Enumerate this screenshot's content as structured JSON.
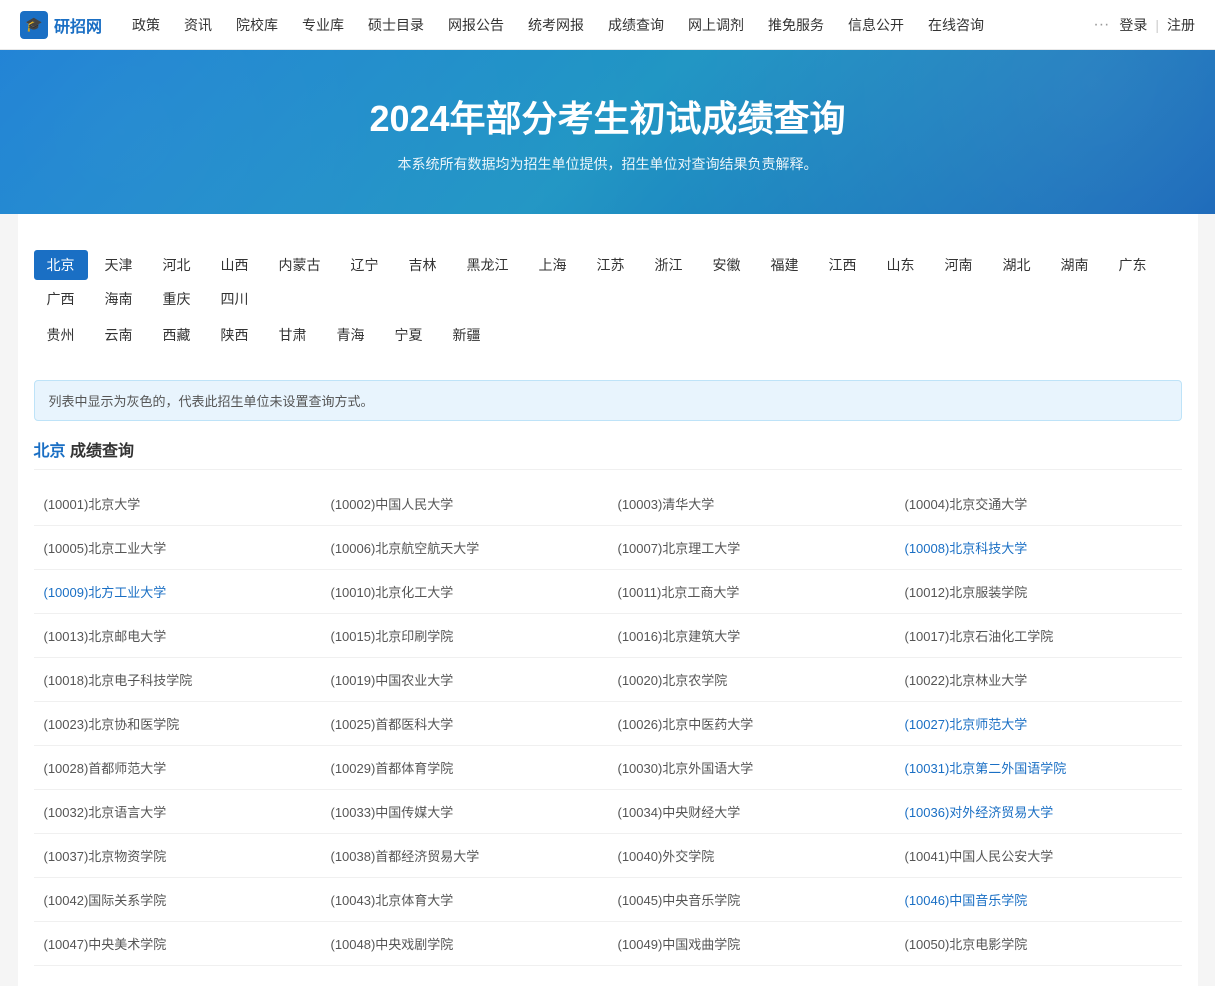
{
  "navbar": {
    "logo_icon": "🎓",
    "logo_text": "研招网",
    "nav_items": [
      {
        "label": "政策",
        "url": "#"
      },
      {
        "label": "资讯",
        "url": "#"
      },
      {
        "label": "院校库",
        "url": "#"
      },
      {
        "label": "专业库",
        "url": "#"
      },
      {
        "label": "硕士目录",
        "url": "#"
      },
      {
        "label": "网报公告",
        "url": "#"
      },
      {
        "label": "统考网报",
        "url": "#"
      },
      {
        "label": "成绩查询",
        "url": "#"
      },
      {
        "label": "网上调剂",
        "url": "#"
      },
      {
        "label": "推免服务",
        "url": "#"
      },
      {
        "label": "信息公开",
        "url": "#"
      },
      {
        "label": "在线咨询",
        "url": "#"
      }
    ],
    "more": "···",
    "login": "登录",
    "register": "注册",
    "sep": "|"
  },
  "hero": {
    "title": "2024年部分考生初试成绩查询",
    "subtitle": "本系统所有数据均为招生单位提供，招生单位对查询结果负责解释。"
  },
  "region_rows": [
    [
      "北京",
      "天津",
      "河北",
      "山西",
      "内蒙古",
      "辽宁",
      "吉林",
      "黑龙江",
      "上海",
      "江苏",
      "浙江",
      "安徽",
      "福建",
      "江西",
      "山东",
      "河南",
      "湖北",
      "湖南",
      "广东",
      "广西",
      "海南",
      "重庆",
      "四川"
    ],
    [
      "贵州",
      "云南",
      "西藏",
      "陕西",
      "甘肃",
      "青海",
      "宁夏",
      "新疆"
    ]
  ],
  "active_region": "北京",
  "notice": "列表中显示为灰色的，代表此招生单位未设置查询方式。",
  "section": {
    "region": "北京",
    "suffix": " 成绩查询"
  },
  "universities": [
    [
      {
        "code": "10001",
        "name": "北京大学",
        "clickable": false
      },
      {
        "code": "10002",
        "name": "中国人民大学",
        "clickable": false
      },
      {
        "code": "10003",
        "name": "清华大学",
        "clickable": false
      },
      {
        "code": "10004",
        "name": "北京交通大学",
        "clickable": false
      }
    ],
    [
      {
        "code": "10005",
        "name": "北京工业大学",
        "clickable": false
      },
      {
        "code": "10006",
        "name": "北京航空航天大学",
        "clickable": false
      },
      {
        "code": "10007",
        "name": "北京理工大学",
        "clickable": false
      },
      {
        "code": "10008",
        "name": "北京科技大学",
        "clickable": true
      }
    ],
    [
      {
        "code": "10009",
        "name": "北方工业大学",
        "clickable": true
      },
      {
        "code": "10010",
        "name": "北京化工大学",
        "clickable": false
      },
      {
        "code": "10011",
        "name": "北京工商大学",
        "clickable": false
      },
      {
        "code": "10012",
        "name": "北京服装学院",
        "clickable": false
      }
    ],
    [
      {
        "code": "10013",
        "name": "北京邮电大学",
        "clickable": false
      },
      {
        "code": "10015",
        "name": "北京印刷学院",
        "clickable": false
      },
      {
        "code": "10016",
        "name": "北京建筑大学",
        "clickable": false
      },
      {
        "code": "10017",
        "name": "北京石油化工学院",
        "clickable": false
      }
    ],
    [
      {
        "code": "10018",
        "name": "北京电子科技学院",
        "clickable": false
      },
      {
        "code": "10019",
        "name": "中国农业大学",
        "clickable": false
      },
      {
        "code": "10020",
        "name": "北京农学院",
        "clickable": false
      },
      {
        "code": "10022",
        "name": "北京林业大学",
        "clickable": false
      }
    ],
    [
      {
        "code": "10023",
        "name": "北京协和医学院",
        "clickable": false
      },
      {
        "code": "10025",
        "name": "首都医科大学",
        "clickable": false
      },
      {
        "code": "10026",
        "name": "北京中医药大学",
        "clickable": false
      },
      {
        "code": "10027",
        "name": "北京师范大学",
        "clickable": true
      }
    ],
    [
      {
        "code": "10028",
        "name": "首都师范大学",
        "clickable": false
      },
      {
        "code": "10029",
        "name": "首都体育学院",
        "clickable": false
      },
      {
        "code": "10030",
        "name": "北京外国语大学",
        "clickable": false
      },
      {
        "code": "10031",
        "name": "北京第二外国语学院",
        "clickable": true
      }
    ],
    [
      {
        "code": "10032",
        "name": "北京语言大学",
        "clickable": false
      },
      {
        "code": "10033",
        "name": "中国传媒大学",
        "clickable": false
      },
      {
        "code": "10034",
        "name": "中央财经大学",
        "clickable": false
      },
      {
        "code": "10036",
        "name": "对外经济贸易大学",
        "clickable": true
      }
    ],
    [
      {
        "code": "10037",
        "name": "北京物资学院",
        "clickable": false
      },
      {
        "code": "10038",
        "name": "首都经济贸易大学",
        "clickable": false
      },
      {
        "code": "10040",
        "name": "外交学院",
        "clickable": false
      },
      {
        "code": "10041",
        "name": "中国人民公安大学",
        "clickable": false
      }
    ],
    [
      {
        "code": "10042",
        "name": "国际关系学院",
        "clickable": false
      },
      {
        "code": "10043",
        "name": "北京体育大学",
        "clickable": false
      },
      {
        "code": "10045",
        "name": "中央音乐学院",
        "clickable": false
      },
      {
        "code": "10046",
        "name": "中国音乐学院",
        "clickable": true
      }
    ],
    [
      {
        "code": "10047",
        "name": "中央美术学院",
        "clickable": false
      },
      {
        "code": "10048",
        "name": "中央戏剧学院",
        "clickable": false
      },
      {
        "code": "10049",
        "name": "中国戏曲学院",
        "clickable": false
      },
      {
        "code": "10050",
        "name": "北京电影学院",
        "clickable": false
      }
    ]
  ]
}
